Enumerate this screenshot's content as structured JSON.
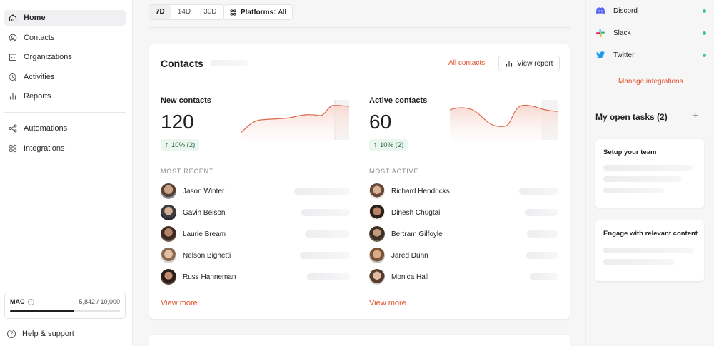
{
  "sidebar": {
    "items": [
      {
        "label": "Home",
        "icon": "home-icon",
        "active": true
      },
      {
        "label": "Contacts",
        "icon": "contacts-icon"
      },
      {
        "label": "Organizations",
        "icon": "organizations-icon"
      },
      {
        "label": "Activities",
        "icon": "activities-icon"
      },
      {
        "label": "Reports",
        "icon": "reports-icon"
      },
      {
        "label": "Automations",
        "icon": "automations-icon"
      },
      {
        "label": "Integrations",
        "icon": "integrations-icon"
      }
    ],
    "mac": {
      "label": "MAC",
      "count": "5,842 / 10,000",
      "fraction": 0.5842
    },
    "help": "Help & support"
  },
  "filters": {
    "periods": [
      "7D",
      "14D",
      "30D"
    ],
    "active_period": "7D",
    "platforms_label": "Platforms:",
    "platforms_value": "All"
  },
  "contacts_card": {
    "title": "Contacts",
    "all_contacts": "All contacts",
    "view_report": "View report",
    "new_contacts": {
      "label": "New contacts",
      "value": "120",
      "change": "10% (2)"
    },
    "active_contacts": {
      "label": "Active contacts",
      "value": "60",
      "change": "10% (2)"
    },
    "most_recent": {
      "heading": "MOST RECENT",
      "people": [
        "Jason Winter",
        "Gavin Belson",
        "Laurie Bream",
        "Nelson Bighetti",
        "Russ Hanneman"
      ],
      "view_more": "View more"
    },
    "most_active": {
      "heading": "MOST ACTIVE",
      "people": [
        "Richard Hendricks",
        "Dinesh Chugtai",
        "Bertram Gilfoyle",
        "Jared Dunn",
        "Monica Hall"
      ],
      "view_more": "View more"
    }
  },
  "right_panel": {
    "integrations": [
      {
        "name": "Discord",
        "icon": "discord-icon",
        "status": "connected"
      },
      {
        "name": "Slack",
        "icon": "slack-icon",
        "status": "connected"
      },
      {
        "name": "Twitter",
        "icon": "twitter-icon",
        "status": "connected"
      }
    ],
    "manage_integrations": "Manage integrations",
    "tasks_title": "My open tasks (2)",
    "tasks": [
      {
        "title": "Setup your team"
      },
      {
        "title": "Engage with relevant content"
      }
    ]
  },
  "colors": {
    "accent": "#e0502b",
    "positive": "#2a6b42",
    "status_dot": "#3ec981"
  }
}
